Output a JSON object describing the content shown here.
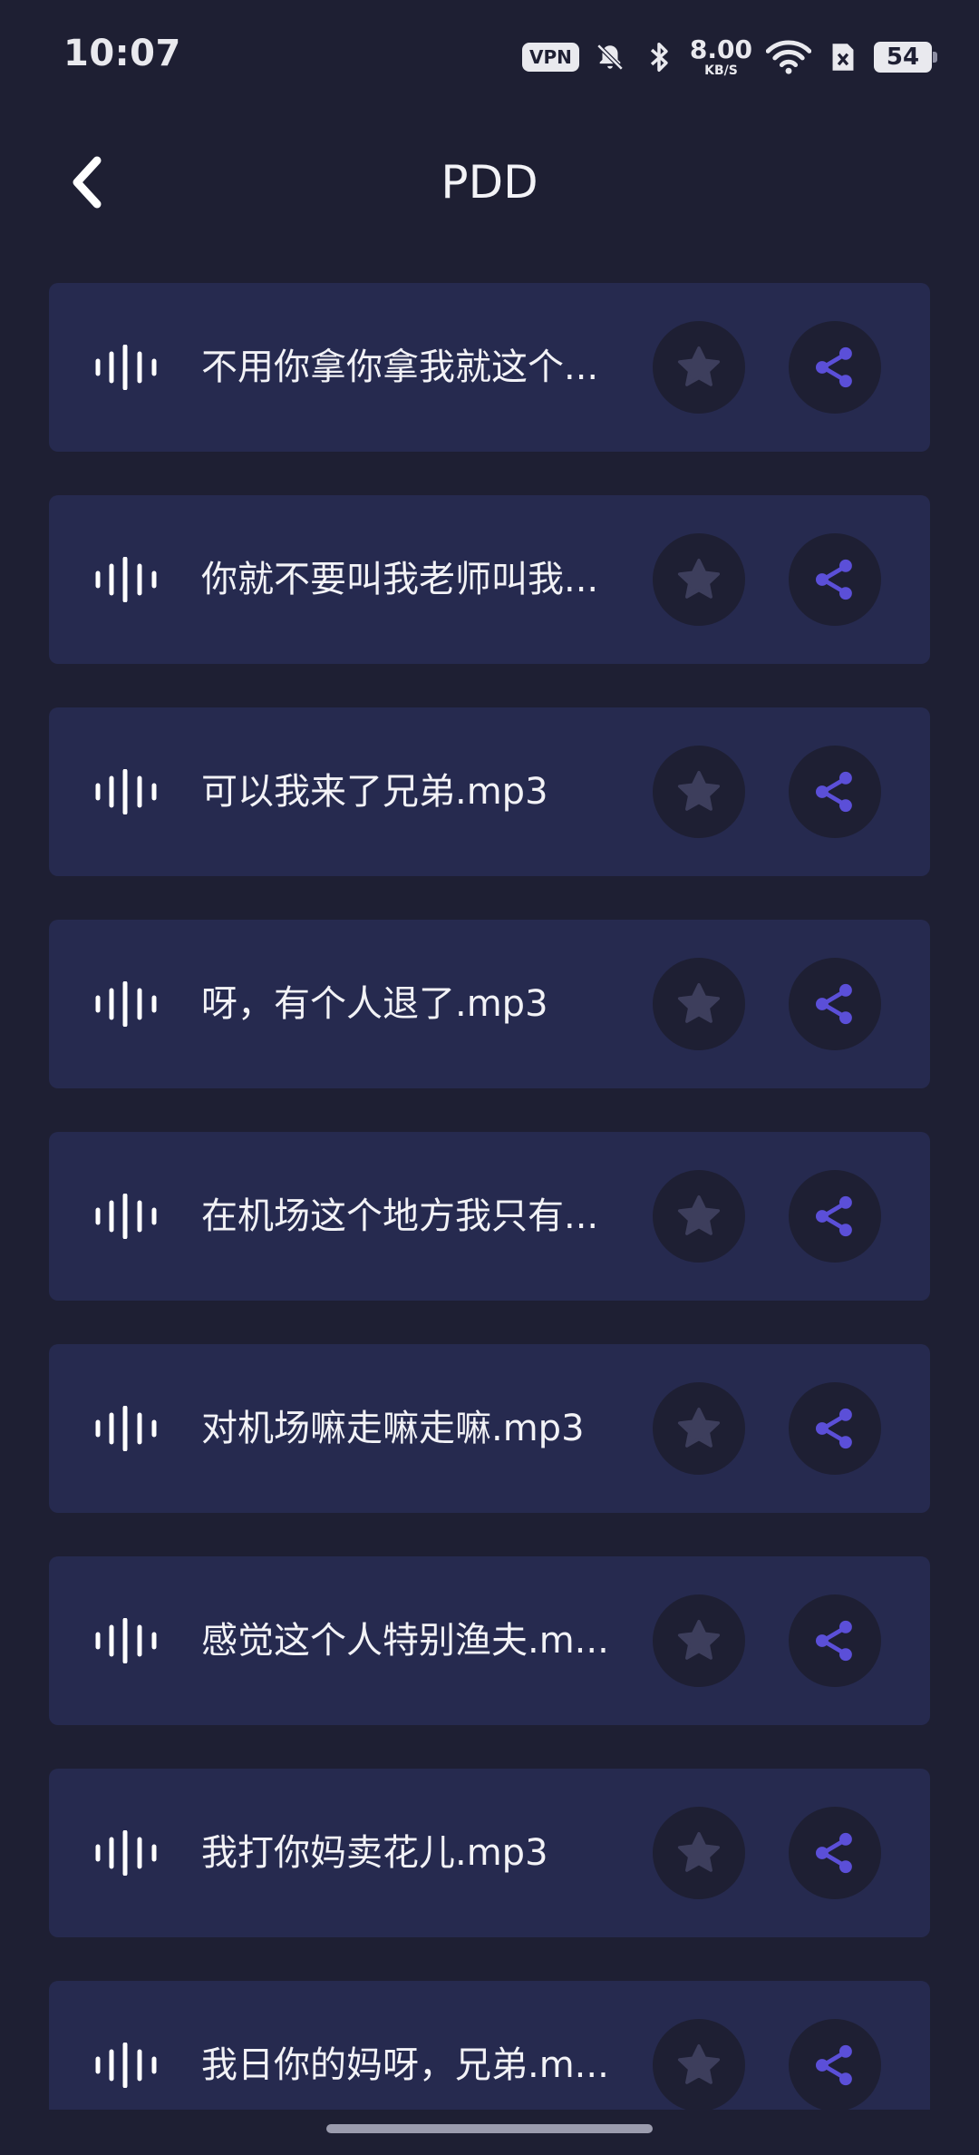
{
  "status_bar": {
    "time": "10:07",
    "vpn": "VPN",
    "net_speed_value": "8.00",
    "net_speed_unit": "KB/S",
    "battery": "54"
  },
  "header": {
    "title": "PDD"
  },
  "icons": {
    "back": "chevron-left-icon",
    "wave": "audio-wave-icon",
    "favorite": "star-icon",
    "share": "share-icon"
  },
  "colors": {
    "background": "#1e1f33",
    "card": "#262a4f",
    "accent": "#5b4fd8",
    "favorite_icon": "#3d3e5c"
  },
  "items": [
    {
      "title": "不用你拿你拿我就这个..."
    },
    {
      "title": "你就不要叫我老师叫我..."
    },
    {
      "title": "可以我来了兄弟.mp3"
    },
    {
      "title": "呀，有个人退了.mp3"
    },
    {
      "title": "在机场这个地方我只有..."
    },
    {
      "title": "对机场嘛走嘛走嘛.mp3"
    },
    {
      "title": "感觉这个人特别渔夫.m..."
    },
    {
      "title": "我打你妈卖花儿.mp3"
    },
    {
      "title": "我日你的妈呀，兄弟.m..."
    }
  ]
}
